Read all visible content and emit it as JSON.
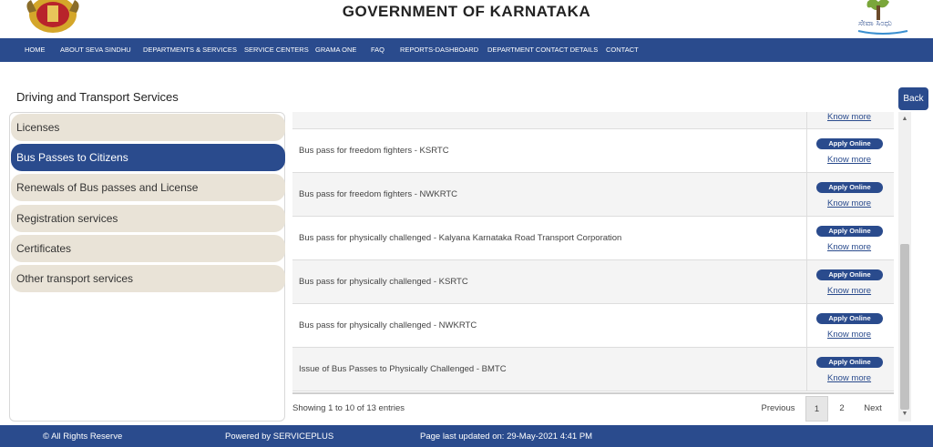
{
  "header": {
    "title": "GOVERNMENT OF KARNATAKA",
    "emblem_icon": "karnataka-emblem-icon",
    "seva_logo_text": "ಸೇವಾ ಸಿಂಧು"
  },
  "nav": {
    "items": [
      "HOME",
      "ABOUT SEVA SINDHU",
      "DEPARTMENTS & SERVICES",
      "SERVICE CENTERS",
      "GRAMA ONE",
      "FAQ",
      "REPORTS-DASHBOARD",
      "DEPARTMENT CONTACT DETAILS",
      "CONTACT"
    ]
  },
  "page": {
    "title": "Driving and Transport Services",
    "back_label": "Back"
  },
  "categories": [
    {
      "label": "Licenses",
      "active": false
    },
    {
      "label": "Bus Passes to Citizens",
      "active": true
    },
    {
      "label": "Renewals of Bus passes and License",
      "active": false
    },
    {
      "label": "Registration services",
      "active": false
    },
    {
      "label": "Certificates",
      "active": false
    },
    {
      "label": "Other transport services",
      "active": false
    }
  ],
  "services": {
    "apply_label": "Apply Online",
    "know_label": "Know more",
    "rows": [
      "Bus pass for freedom fighters - KSRTC",
      "Bus pass for freedom fighters - NWKRTC",
      "Bus pass for physically challenged - Kalyana Karnataka Road Transport Corporation",
      "Bus pass for physically challenged - KSRTC",
      "Bus pass for physically challenged - NWKRTC",
      "Issue of Bus Passes to Physically Challenged - BMTC"
    ]
  },
  "pagination": {
    "showing": "Showing 1 to 10 of 13 entries",
    "previous": "Previous",
    "page1": "1",
    "page2": "2",
    "next": "Next"
  },
  "footer": {
    "rights": "© All Rights Reserve",
    "powered": "Powered by SERVICEPLUS",
    "updated": "Page last updated on: 29-May-2021 4:41 PM"
  },
  "colors": {
    "brand_blue": "#2a4b8d",
    "category_bg": "#e9e3d7"
  }
}
